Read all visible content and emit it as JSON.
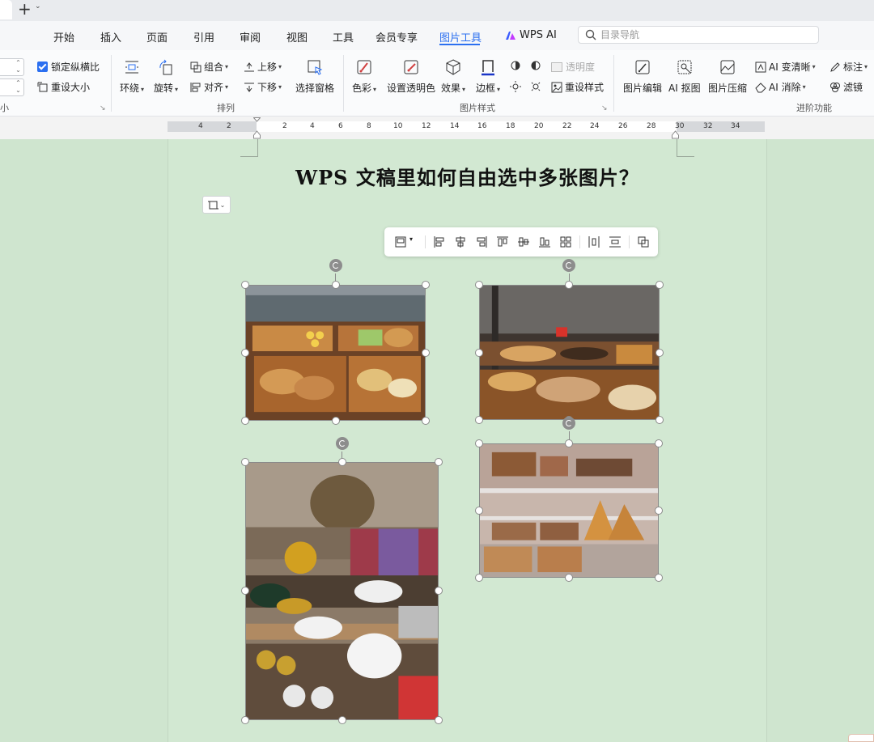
{
  "menu": {
    "tabs": [
      {
        "label": "开始"
      },
      {
        "label": "插入"
      },
      {
        "label": "页面"
      },
      {
        "label": "引用"
      },
      {
        "label": "审阅"
      },
      {
        "label": "视图"
      },
      {
        "label": "工具"
      },
      {
        "label": "会员专享"
      },
      {
        "label": "图片工具"
      },
      {
        "label": "WPS AI"
      }
    ],
    "active_tab": "图片工具",
    "search_placeholder": "目录导航"
  },
  "ribbon": {
    "size_group": {
      "lock_ratio": "锁定纵横比",
      "reset_size": "重设大小",
      "label": "小"
    },
    "arrange_group": {
      "wrap": "环绕",
      "rotate": "旋转",
      "group": "组合",
      "align": "对齐",
      "move_up": "上移",
      "move_down": "下移",
      "selection_pane": "选择窗格",
      "label": "排列"
    },
    "style_group": {
      "color": "色彩",
      "set_transparent": "设置透明色",
      "effects": "效果",
      "border": "边框",
      "transparency": "透明度",
      "reset_style": "重设样式",
      "label": "图片样式"
    },
    "advanced_group": {
      "picture_edit": "图片编辑",
      "ai_cutout": "AI 抠图",
      "picture_compress": "图片压缩",
      "ai_sharpen": "AI 变清晰",
      "ai_erase": "AI 消除",
      "annotate": "标注",
      "filter": "滤镜",
      "label": "进阶功能"
    }
  },
  "ruler": {
    "ticks": [
      "4",
      "2",
      "2",
      "4",
      "6",
      "8",
      "10",
      "12",
      "14",
      "16",
      "18",
      "20",
      "22",
      "24",
      "26",
      "28",
      "30",
      "32",
      "34"
    ]
  },
  "document": {
    "title": "WPS 文稿里如何自由选中多张图片？"
  },
  "colors": {
    "accent": "#2b6ff0",
    "doc_background": "#cfe5cf"
  }
}
